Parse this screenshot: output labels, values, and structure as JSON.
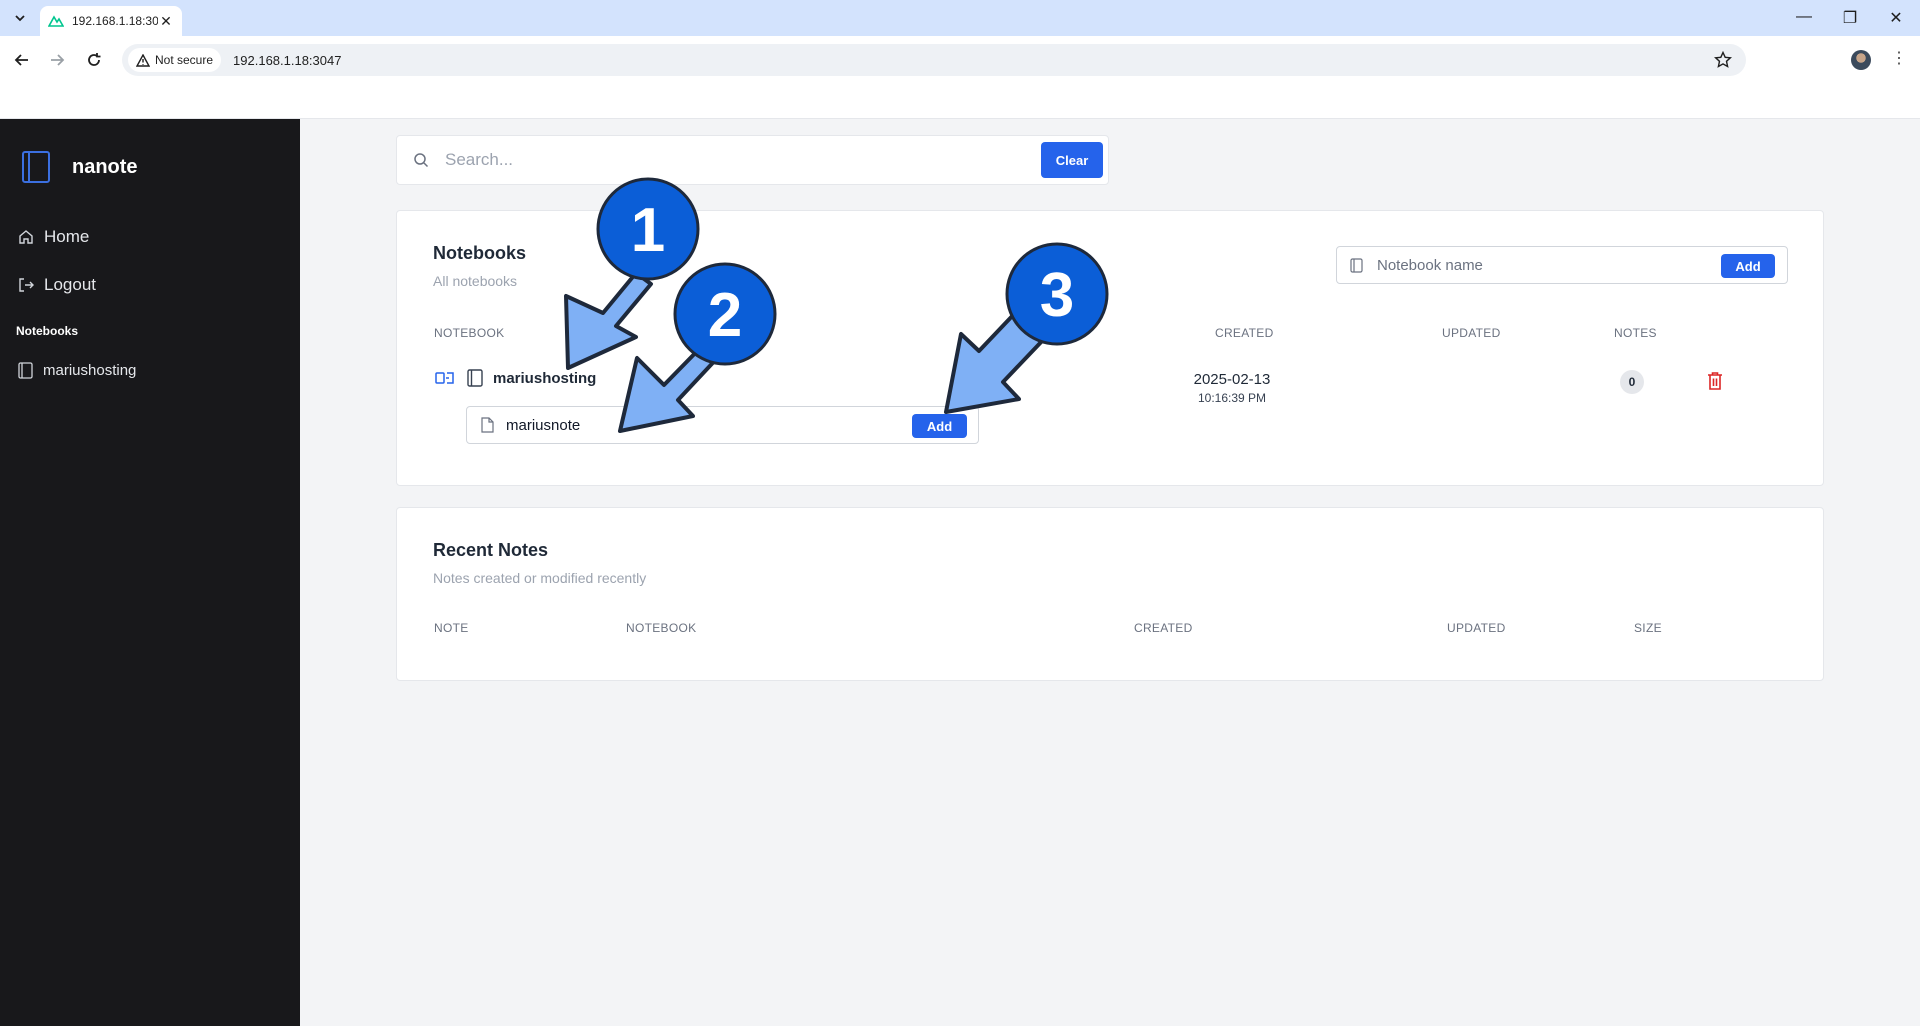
{
  "browser": {
    "tab_title": "192.168.1.18:3047",
    "security_chip": "Not secure",
    "url": "192.168.1.18:3047"
  },
  "sidebar": {
    "brand": "nanote",
    "home": "Home",
    "logout": "Logout",
    "notebooks_heading": "Notebooks",
    "notebooks": [
      {
        "name": "mariushosting"
      }
    ]
  },
  "search": {
    "placeholder": "Search...",
    "clear_label": "Clear"
  },
  "notebooks_card": {
    "title": "Notebooks",
    "subtitle": "All notebooks",
    "name_placeholder": "Notebook name",
    "add_label": "Add",
    "columns": [
      "NOTEBOOK",
      "CREATED",
      "UPDATED",
      "NOTES"
    ],
    "rows": [
      {
        "name": "mariushosting",
        "created_date": "2025-02-13",
        "created_time": "10:16:39 PM",
        "updated": "",
        "notes_count": "0"
      }
    ],
    "new_note_value": "mariusnote",
    "new_note_add_label": "Add"
  },
  "recent_card": {
    "title": "Recent Notes",
    "subtitle": "Notes created or modified recently",
    "columns": [
      "NOTE",
      "NOTEBOOK",
      "CREATED",
      "UPDATED",
      "SIZE"
    ]
  },
  "annotations": [
    "1",
    "2",
    "3"
  ],
  "colors": {
    "accent": "#2563eb",
    "sidebar_bg": "#18181b",
    "danger": "#dc2626",
    "annotation_circle": "#0b5ed7",
    "annotation_arrow": "#7fb0f5"
  }
}
